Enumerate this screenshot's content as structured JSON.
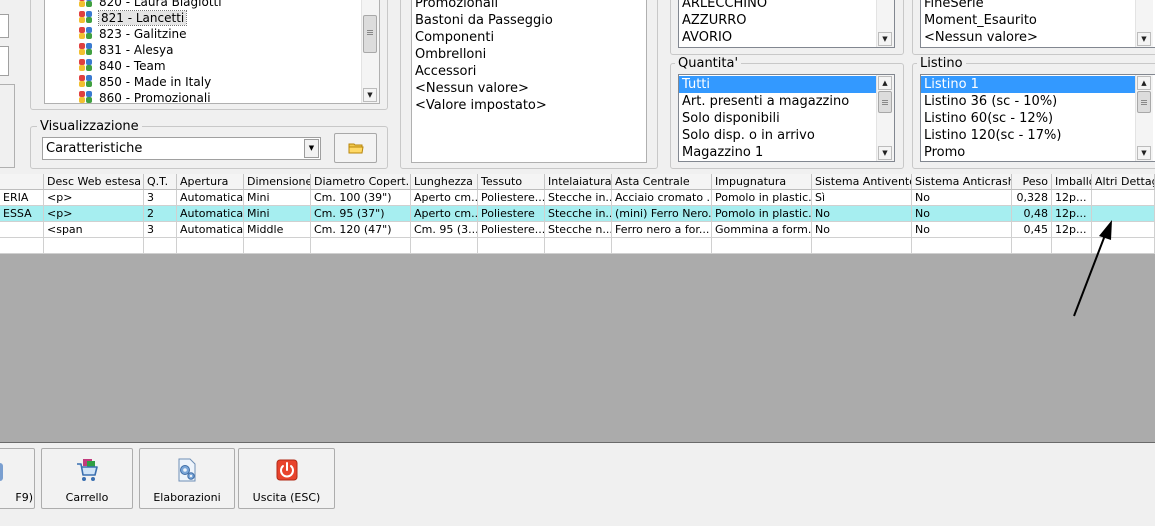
{
  "top_panel": {
    "left_inputs_partial": true,
    "brands_list": [
      {
        "label": "820 - Laura Biagiotti",
        "selected": false
      },
      {
        "label": "821 - Lancetti",
        "selected": true
      },
      {
        "label": "823 - Galitzine",
        "selected": false
      },
      {
        "label": "831 - Alesya",
        "selected": false
      },
      {
        "label": "840 - Team",
        "selected": false
      },
      {
        "label": "850 - Made in Italy",
        "selected": false
      },
      {
        "label": "860 - Promozionali",
        "selected": false
      }
    ],
    "visualizzazione": {
      "legend": "Visualizzazione",
      "selected_value": "Caratteristiche",
      "folder_icon": "folder-icon"
    },
    "categories_list": [
      "Promozionali",
      "Bastoni da Passeggio",
      "Componenti",
      "Ombrelloni",
      "Accessori",
      "<Nessun valore>",
      "<Valore impostato>"
    ],
    "colors_list": [
      "ARLECCHINO",
      "AZZURRO",
      "AVORIO"
    ],
    "series_list": [
      "FineSerie",
      "Moment_Esaurito",
      "<Nessun valore>"
    ],
    "quantita": {
      "legend": "Quantita'",
      "items": [
        {
          "label": "Tutti",
          "selected": true
        },
        {
          "label": "Art. presenti a magazzino",
          "selected": false
        },
        {
          "label": "Solo disponibili",
          "selected": false
        },
        {
          "label": "Solo disp. o in arrivo",
          "selected": false
        },
        {
          "label": "Magazzino 1",
          "selected": false
        }
      ]
    },
    "listino": {
      "legend": "Listino",
      "items": [
        {
          "label": "Listino 1",
          "selected": true
        },
        {
          "label": "Listino 36 (sc - 10%)",
          "selected": false
        },
        {
          "label": "Listino 60(sc - 12%)",
          "selected": false
        },
        {
          "label": "Listino 120(sc - 17%)",
          "selected": false
        },
        {
          "label": "Promo",
          "selected": false
        }
      ]
    }
  },
  "grid": {
    "columns": [
      "",
      "Desc Web estesa",
      "Q.T.",
      "Apertura",
      "Dimensione",
      "Diametro Copert...",
      "Lunghezza",
      "Tessuto",
      "Intelaiatura",
      "Asta Centrale",
      "Impugnatura",
      "Sistema Antivento",
      "Sistema Anticrash",
      "Peso",
      "Imballo",
      "Altri Dettagli"
    ],
    "rows": [
      {
        "selected": false,
        "cells": [
          "ERIA",
          "<p>",
          "3",
          "Automatica",
          "Mini",
          "Cm. 100 (39\")",
          "Aperto cm...",
          "Poliestere...",
          "Stecche in...",
          "Acciaio cromato ...",
          "Pomolo in plastic...",
          "Sì",
          "No",
          "0,328",
          "12p...",
          ""
        ]
      },
      {
        "selected": true,
        "cells": [
          "ESSA",
          "<p>",
          "2",
          "Automatica",
          "Mini",
          "Cm. 95 (37\")",
          "Aperto cm...",
          "Poliestere",
          "Stecche in...",
          "(mini) Ferro Nero...",
          "Pomolo in plastic...",
          "No",
          "No",
          "0,48",
          "12p...",
          ""
        ]
      },
      {
        "selected": false,
        "cells": [
          "",
          "<span",
          "3",
          "Automatica",
          "Middle",
          "Cm. 120 (47\")",
          "Cm. 95 (3...",
          "Poliestere...",
          "Stecche n...",
          "Ferro nero a for...",
          "Gommina a form...",
          "No",
          "No",
          "0,45",
          "12p...",
          ""
        ]
      }
    ]
  },
  "toolbar": {
    "buttons": [
      {
        "label": "F9)",
        "icon": "partial-icon"
      },
      {
        "label": "Carrello",
        "icon": "cart-icon"
      },
      {
        "label": "Elaborazioni",
        "icon": "gear-document-icon"
      },
      {
        "label": "Uscita (ESC)",
        "icon": "power-icon"
      }
    ]
  },
  "colors": {
    "selection_blue": "#3399ff",
    "selected_row": "#a6eef0",
    "gray_area": "#ababab",
    "exit_red": "#e8432c"
  }
}
